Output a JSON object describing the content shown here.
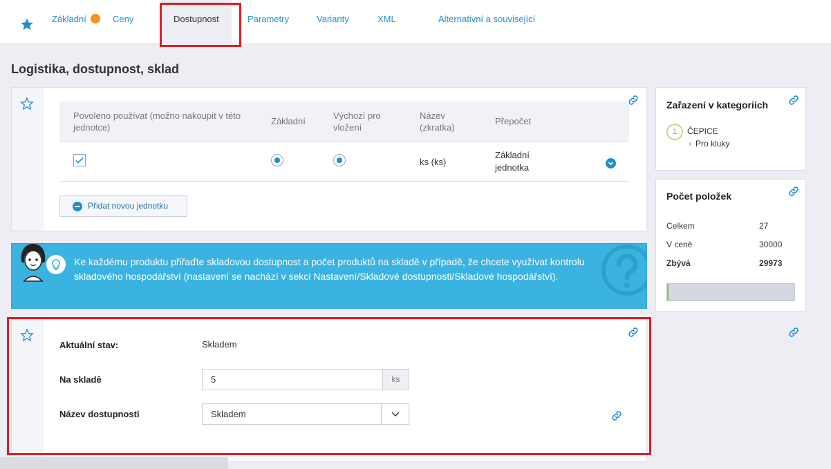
{
  "tabs": [
    {
      "label": "Základní"
    },
    {
      "label": "Ceny"
    },
    {
      "label": "Dostupnost"
    },
    {
      "label": "Parametry"
    },
    {
      "label": "Varianty"
    },
    {
      "label": "XML"
    },
    {
      "label": "Alternativní a související"
    }
  ],
  "page_title": "Logistika, dostupnost, sklad",
  "units_table": {
    "headers": [
      "Povoleno používat (možno nakoupit v této jednotce)",
      "Základní",
      "Výchozí pro vložení",
      "Název (zkratka)",
      "Přepočet"
    ],
    "row": {
      "name": "ks (ks)",
      "conversion": "Základní jednotka",
      "allowed": true,
      "basic": true,
      "default": true
    },
    "add_button": "Přidat novou jednotku"
  },
  "banner": {
    "text": "Ke každému produktu přiřaďte skladovou dostupnost a počet produktů na skladě v případě, že chcete využívat kontrolu skladového hospodářství (nastavení se nachází v sekci Nastavení/Skladové dostupnosti/Skladové hospodářství)."
  },
  "stock": {
    "current_label": "Aktuální stav:",
    "current_value": "Skladem",
    "qty_label": "Na skladě",
    "qty_value": "5",
    "qty_unit": "ks",
    "availability_label": "Název dostupnosti",
    "availability_value": "Skladem"
  },
  "categories": {
    "title": "Zařazení v kategoriích",
    "index": "1",
    "parent": "ČEPICE",
    "child": "Pro kluky"
  },
  "item_count": {
    "title": "Počet položek",
    "rows": [
      {
        "label": "Celkem",
        "value": "27"
      },
      {
        "label": "V ceně",
        "value": "30000"
      },
      {
        "label": "Zbývá",
        "value": "29973"
      }
    ],
    "progress_fraction": 0.01
  },
  "colors": {
    "accent": "#1d8fcf",
    "banner": "#3bb3e0",
    "highlight": "#e01b24",
    "badge": "#f39324"
  }
}
